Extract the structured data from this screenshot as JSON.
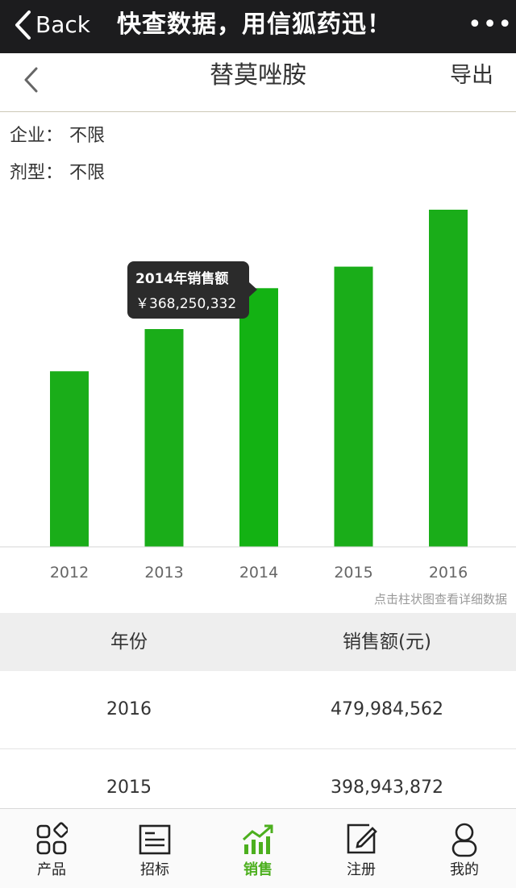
{
  "top_bar": {
    "back_label": "Back",
    "title": "快查数据，用信狐药迅！",
    "more_label": "•••"
  },
  "nav": {
    "title": "替莫唑胺",
    "export_label": "导出"
  },
  "filters": {
    "company": {
      "key": "企业：",
      "value": "不限"
    },
    "dosage": {
      "key": "剂型：",
      "value": "不限"
    }
  },
  "chart_data": {
    "type": "bar",
    "categories": [
      "2012",
      "2013",
      "2014",
      "2015",
      "2016"
    ],
    "values": [
      250000000,
      310000000,
      368250332,
      398943872,
      479984562
    ],
    "ylim": [
      0,
      480000000
    ],
    "grid": false,
    "bar_color": "#1aad19",
    "highlight_color": "#13b213"
  },
  "tooltip": {
    "title": "2014年销售额",
    "value": "￥368,250,332"
  },
  "hint": "点击柱状图查看详细数据",
  "table": {
    "headers": [
      "年份",
      "销售额(元)"
    ],
    "rows": [
      {
        "year": "2016",
        "sales": "479,984,562"
      },
      {
        "year": "2015",
        "sales": "398,943,872"
      }
    ]
  },
  "tabs": [
    {
      "label": "产品",
      "icon": "grid-icon"
    },
    {
      "label": "招标",
      "icon": "document-icon"
    },
    {
      "label": "销售",
      "icon": "chart-icon"
    },
    {
      "label": "注册",
      "icon": "edit-icon"
    },
    {
      "label": "我的",
      "icon": "person-icon"
    }
  ],
  "colors": {
    "accent": "#4caf1e",
    "topbar": "#1c1c1e"
  }
}
